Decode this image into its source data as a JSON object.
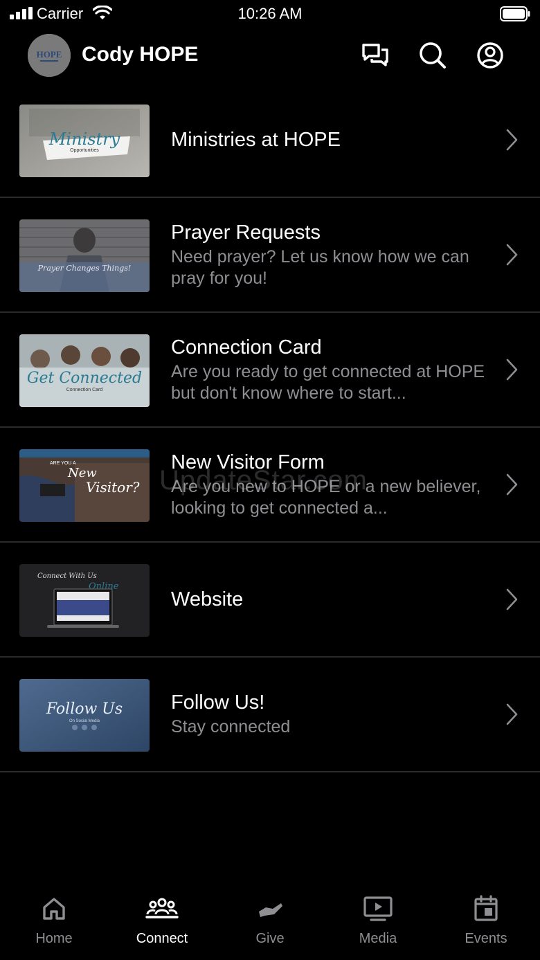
{
  "status_bar": {
    "carrier": "Carrier",
    "time": "10:26 AM"
  },
  "header": {
    "title": "Cody HOPE",
    "avatar_text": "HOPE"
  },
  "items": [
    {
      "title": "Ministries at HOPE",
      "subtitle": "",
      "thumb_text": "Ministry",
      "thumb_subtext": "Opportunities"
    },
    {
      "title": "Prayer Requests",
      "subtitle": "Need prayer? Let us know how we can pray for you!",
      "thumb_text": "Prayer Changes Things!"
    },
    {
      "title": "Connection Card",
      "subtitle": "Are you ready to get connected at HOPE but don't know where to start...",
      "thumb_text": "Get Connected",
      "thumb_subtext": "Connection Card"
    },
    {
      "title": "New Visitor Form",
      "subtitle": "Are you new to HOPE or a new believer, looking to get connected a...",
      "thumb_text": "Visitor?",
      "thumb_pretext": "ARE YOU A",
      "thumb_midtext": "New"
    },
    {
      "title": "Website",
      "subtitle": "",
      "thumb_text": "Connect With Us",
      "thumb_subtext": "Online"
    },
    {
      "title": "Follow Us!",
      "subtitle": "Stay connected",
      "thumb_text": "Follow Us",
      "thumb_subtext": "On Social Media"
    }
  ],
  "watermark": "UpdateStar.com",
  "tabs": [
    {
      "label": "Home",
      "icon": "home-icon",
      "active": false
    },
    {
      "label": "Connect",
      "icon": "people-icon",
      "active": true
    },
    {
      "label": "Give",
      "icon": "give-icon",
      "active": false
    },
    {
      "label": "Media",
      "icon": "media-icon",
      "active": false
    },
    {
      "label": "Events",
      "icon": "calendar-icon",
      "active": false
    }
  ],
  "colors": {
    "background": "#000000",
    "divider": "#2a2a2a",
    "subtitle": "#8e8e93",
    "inactive_tab": "#8e8e93",
    "active_tab": "#ffffff"
  }
}
